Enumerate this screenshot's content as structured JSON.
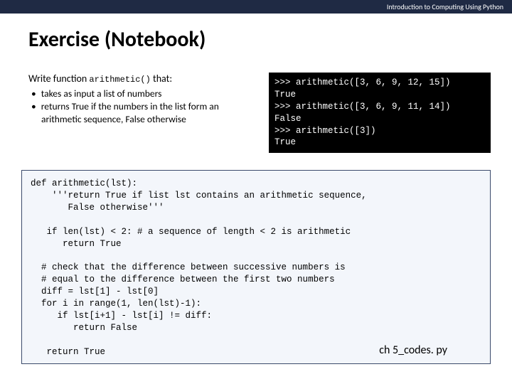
{
  "header": {
    "course": "Introduction to Computing Using Python"
  },
  "title": "Exercise (Notebook)",
  "prompt": {
    "lead": "Write function ",
    "func": "arithmetic()",
    "tail": " that:",
    "bullets": [
      "takes as input a list of numbers",
      "returns True if the numbers in the list form an arithmetic sequence, False otherwise"
    ]
  },
  "terminal": ">>> arithmetic([3, 6, 9, 12, 15])\nTrue\n>>> arithmetic([3, 6, 9, 11, 14])\nFalse\n>>> arithmetic([3])\nTrue",
  "code": "def arithmetic(lst):\n    '''return True if list lst contains an arithmetic sequence,\n       False otherwise'''\n\n   if len(lst) < 2: # a sequence of length < 2 is arithmetic\n      return True\n\n  # check that the difference between successive numbers is\n  # equal to the difference between the first two numbers\n  diff = lst[1] - lst[0]\n  for i in range(1, len(lst)-1):\n     if lst[i+1] - lst[i] != diff:\n        return False\n\n   return True",
  "filename": "ch 5_codes. py"
}
